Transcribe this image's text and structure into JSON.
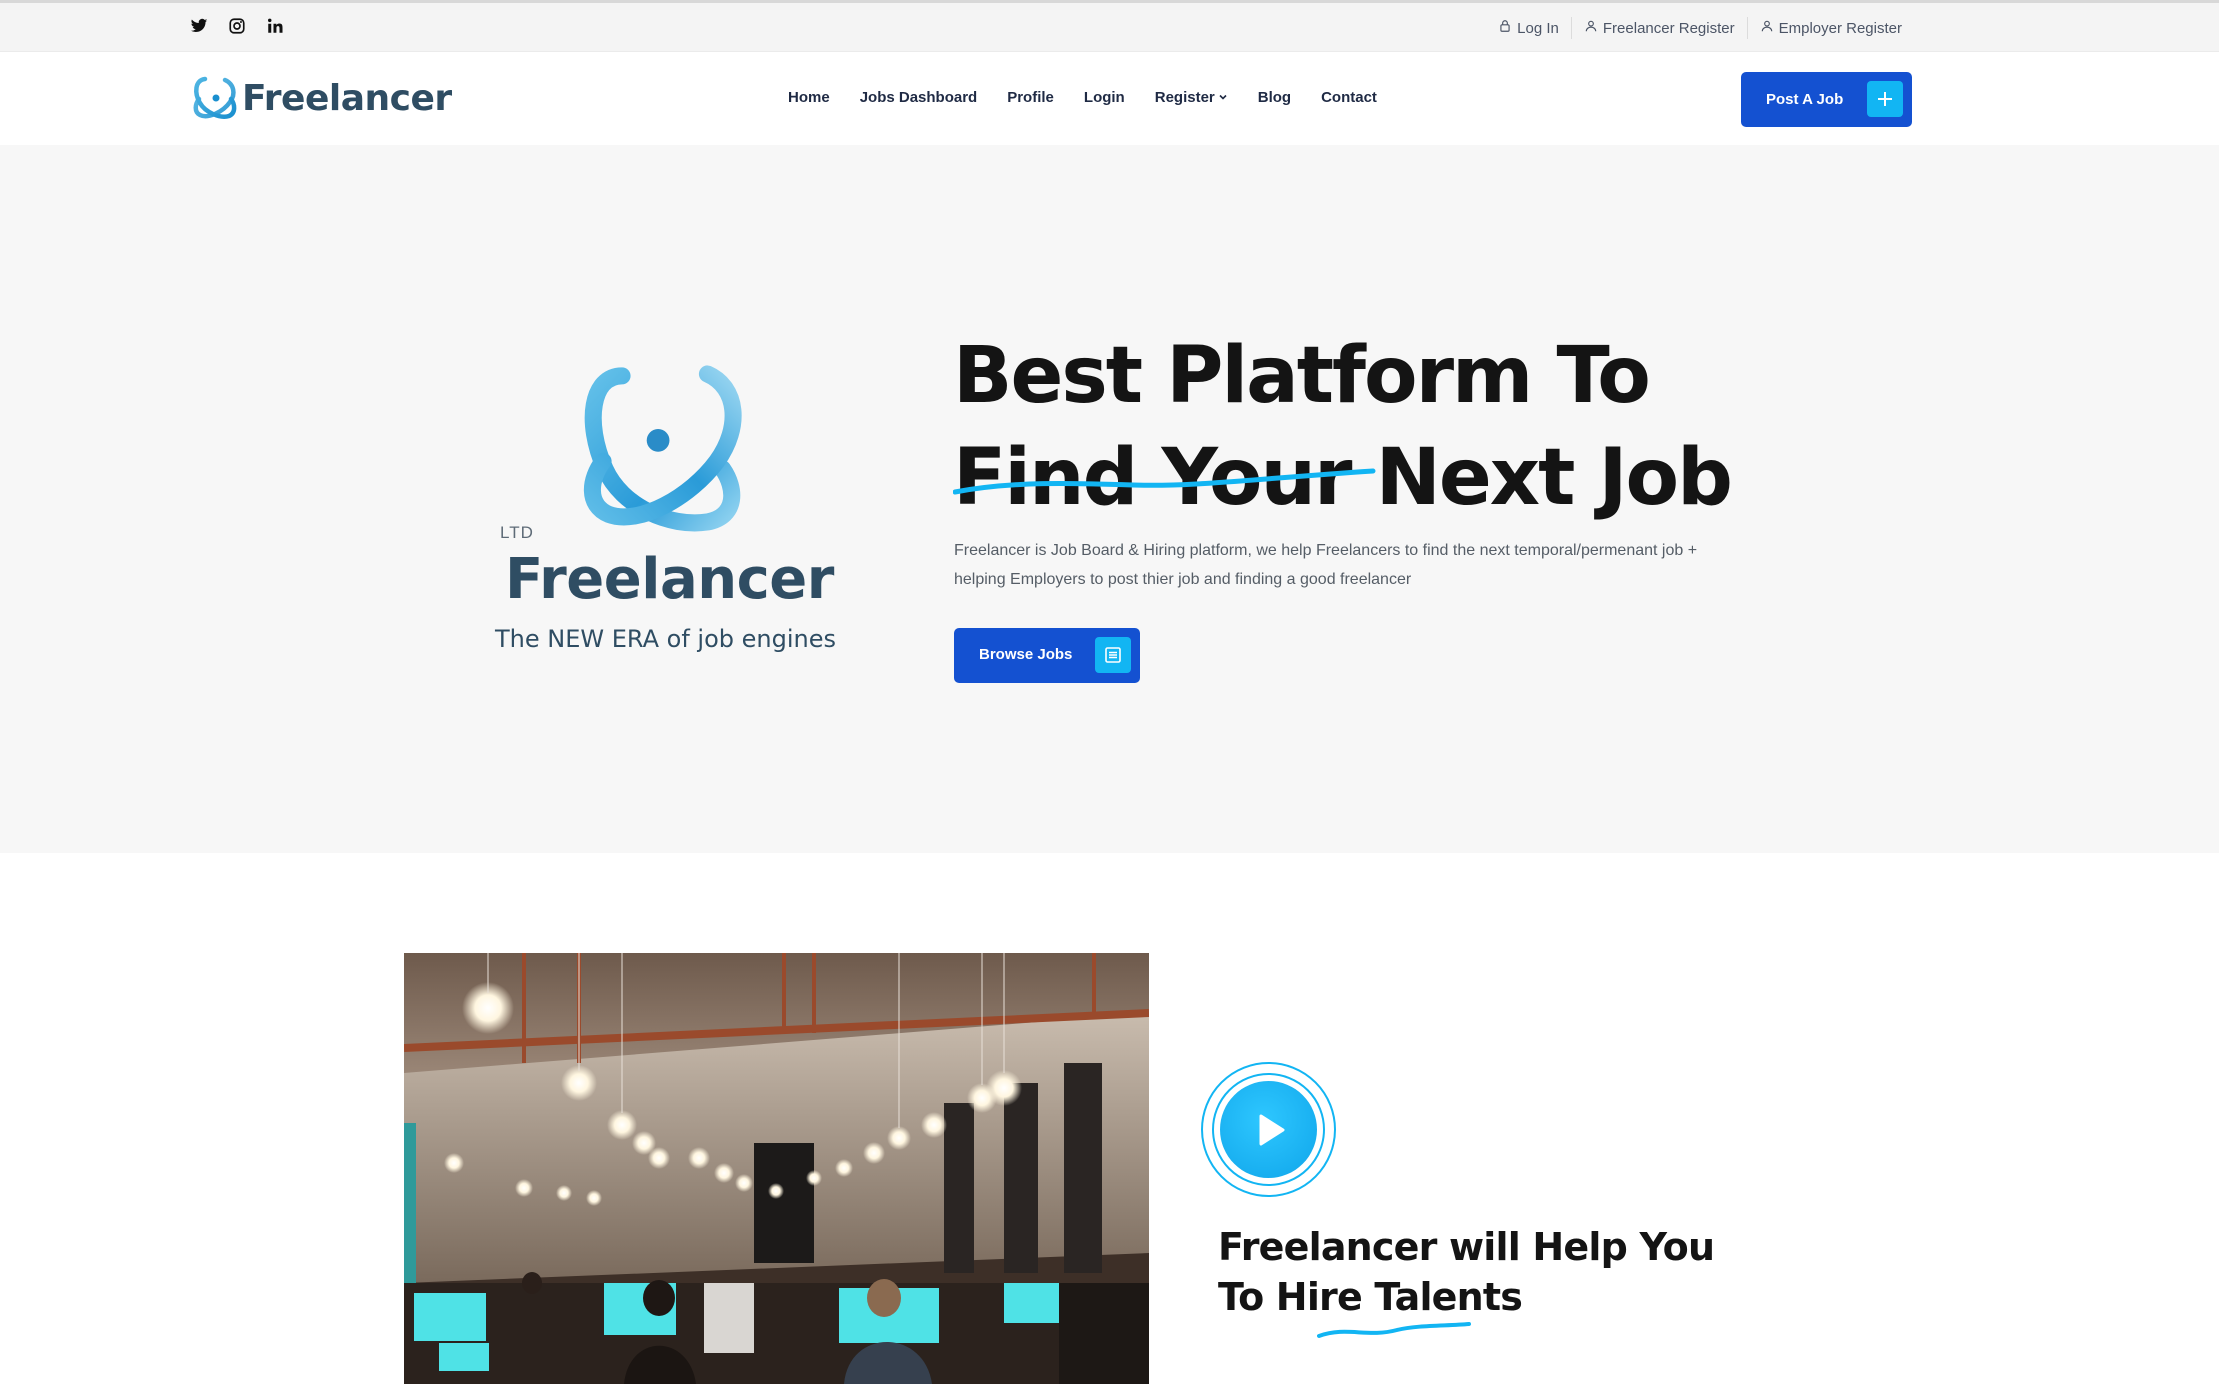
{
  "topbar": {
    "social": [
      {
        "icon": "twitter-icon"
      },
      {
        "icon": "instagram-icon"
      },
      {
        "icon": "linkedin-icon"
      }
    ],
    "links": [
      {
        "label": "Log In",
        "icon": "lock-icon"
      },
      {
        "label": "Freelancer Register",
        "icon": "user-icon"
      },
      {
        "label": "Employer Register",
        "icon": "user-icon"
      }
    ]
  },
  "header": {
    "brand": "Freelancer",
    "nav": [
      "Home",
      "Jobs Dashboard",
      "Profile",
      "Login",
      "Register",
      "Blog",
      "Contact"
    ],
    "post_button": "Post A Job"
  },
  "hero": {
    "logo": {
      "ltd": "LTD",
      "name": "Freelancer",
      "tagline": "The NEW ERA of job engines"
    },
    "title_line1": "Best Platform To",
    "title_line2": "Find Your Next Job",
    "description": "Freelancer is Job Board & Hiring platform, we help Freelancers to find the next temporal/permenant job + helping Employers to post thier job and finding a good freelancer",
    "browse_button": "Browse Jobs"
  },
  "about": {
    "title_line1": "Freelancer will Help You",
    "title_line2": "To Hire Talents"
  },
  "colors": {
    "primary": "#1451d1",
    "accent": "#12b5f3",
    "brand_text": "#2f4d63"
  }
}
